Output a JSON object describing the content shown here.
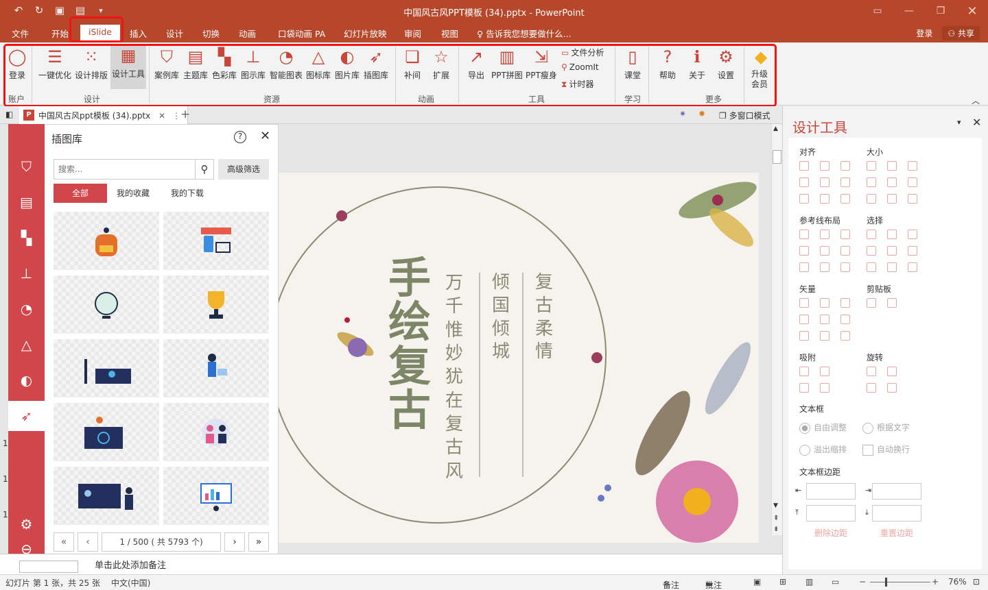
{
  "titlebar": {
    "title": "中国风古风PPT模板 (34).pptx - PowerPoint"
  },
  "menu": {
    "tabs": [
      "文件",
      "开始",
      "iSlide",
      "插入",
      "设计",
      "切换",
      "动画",
      "口袋动画 PA",
      "幻灯片放映",
      "审阅",
      "视图"
    ],
    "tell_me": "告诉我您想要做什么...",
    "login": "登录",
    "share": "共享"
  },
  "ribbon": {
    "buttons": [
      "登录",
      "一键优化",
      "设计排版",
      "设计工具",
      "案例库",
      "主题库",
      "色彩库",
      "图示库",
      "智能图表",
      "图标库",
      "图片库",
      "插图库",
      "补间",
      "扩展",
      "导出",
      "PPT拼图",
      "PPT瘦身",
      "课堂",
      "帮助",
      "关于",
      "设置",
      "升级会员"
    ],
    "small": [
      "文件分析",
      "ZoomIt",
      "计时器"
    ],
    "groups": [
      "账户",
      "设计",
      "资源",
      "动画",
      "工具",
      "学习",
      "更多"
    ]
  },
  "docbar": {
    "tab": "中国风古风ppt模板 (34).pptx",
    "mode": "多窗口模式"
  },
  "panel": {
    "title": "插图库",
    "search_placeholder": "搜索...",
    "advanced": "高级筛选",
    "filters": [
      "全部",
      "我的收藏",
      "我的下载"
    ],
    "page_info": "1 / 500 ( 共 5793 个)"
  },
  "slide": {
    "main_title": "手绘复古",
    "col1": "万千惟妙犹在复古风",
    "col2": "倾国倾城",
    "col3": "复古柔情"
  },
  "notes": {
    "placeholder": "单击此处添加备注"
  },
  "rpane": {
    "title": "设计工具",
    "sections": [
      "对齐",
      "大小",
      "参考线布局",
      "选择",
      "矢量",
      "剪贴板",
      "吸附",
      "旋转",
      "文本框",
      "文本框边距"
    ],
    "textbox_options": [
      "自由调整",
      "根据文字",
      "溢出缩排",
      "自动换行"
    ],
    "links": [
      "删除边距",
      "重置边距"
    ]
  },
  "status": {
    "slide_info": "幻灯片 第 1 张，共 25 张",
    "language": "中文(中国)",
    "notes": "备注",
    "comments": "批注",
    "zoom": "76%"
  },
  "colors": {
    "accent": "#b7472a",
    "islide_red": "#d0464a",
    "highlight": "#f01414"
  }
}
